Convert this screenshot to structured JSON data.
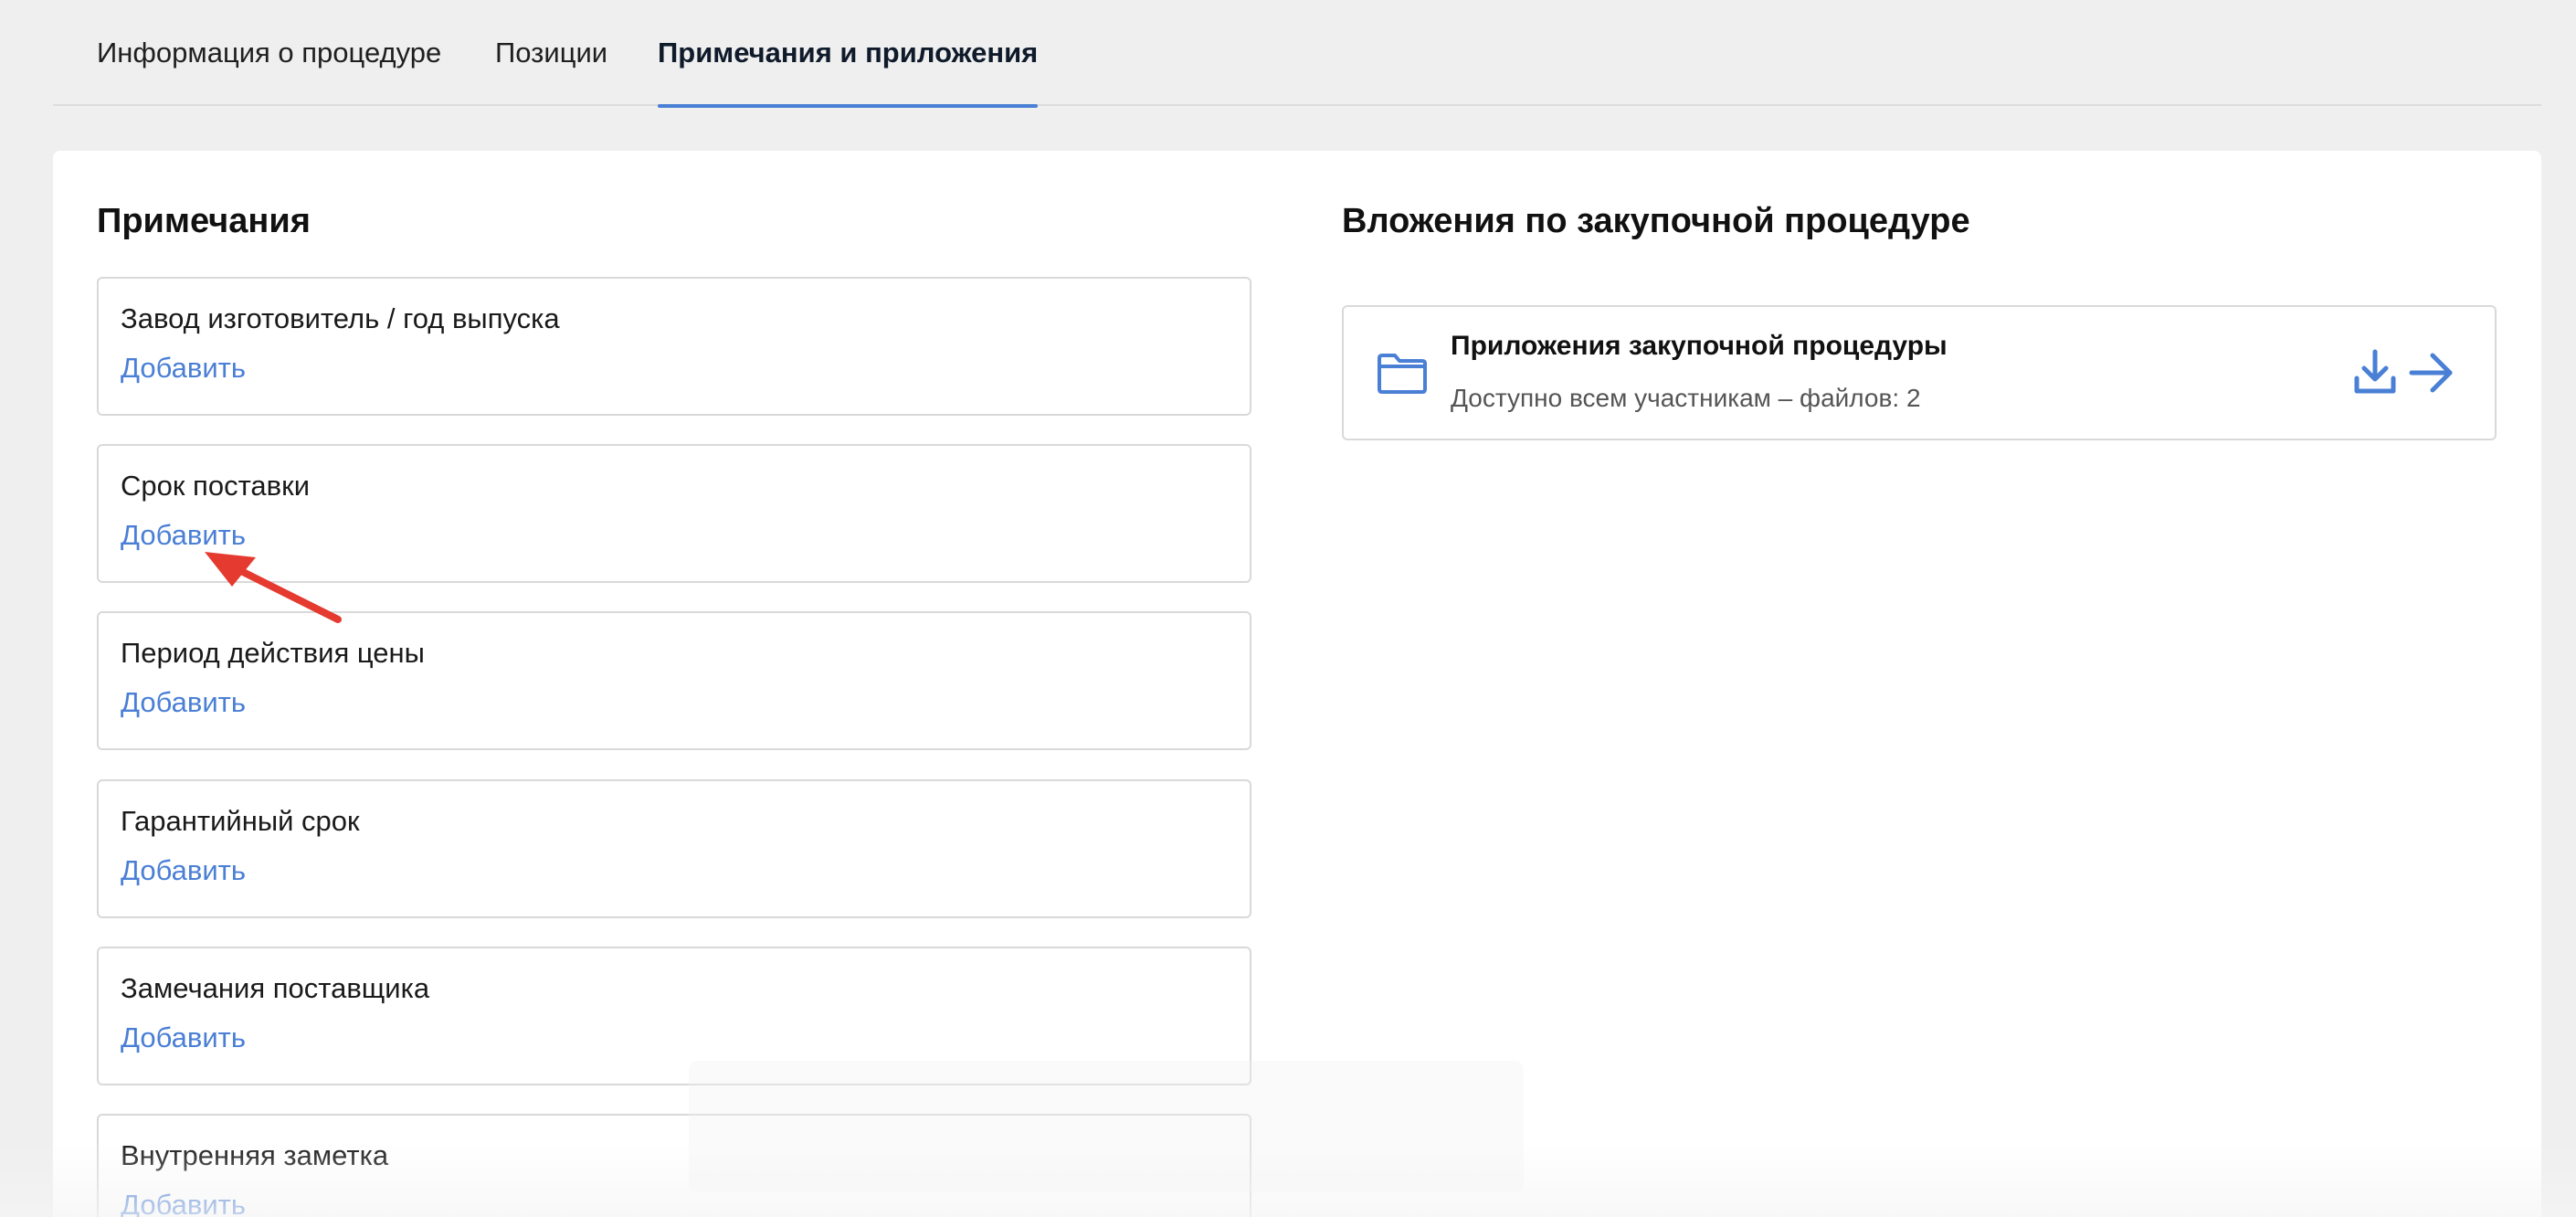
{
  "tabs": [
    {
      "label": "Информация о процедуре",
      "active": false
    },
    {
      "label": "Позиции",
      "active": false
    },
    {
      "label": "Примечания и приложения",
      "active": true
    }
  ],
  "notes": {
    "title": "Примечания",
    "items": [
      {
        "label": "Завод изготовитель / год выпуска",
        "action": "Добавить"
      },
      {
        "label": "Срок поставки",
        "action": "Добавить"
      },
      {
        "label": "Период действия цены",
        "action": "Добавить"
      },
      {
        "label": "Гарантийный срок",
        "action": "Добавить"
      },
      {
        "label": "Замечания поставщика",
        "action": "Добавить"
      },
      {
        "label": "Внутренняя заметка",
        "action": "Добавить"
      }
    ]
  },
  "attachments": {
    "title": "Вложения по закупочной процедуре",
    "folder": {
      "name": "Приложения закупочной процедуры",
      "description": "Доступно всем участникам – файлов: 2",
      "icon": "folder-icon"
    },
    "actions": [
      "download-icon",
      "arrow-right-icon"
    ]
  },
  "colors": {
    "accent": "#4a7fd6",
    "annotation_arrow": "#e53a2f",
    "background": "#efefef",
    "card": "#ffffff",
    "border": "#d9d9d9"
  }
}
